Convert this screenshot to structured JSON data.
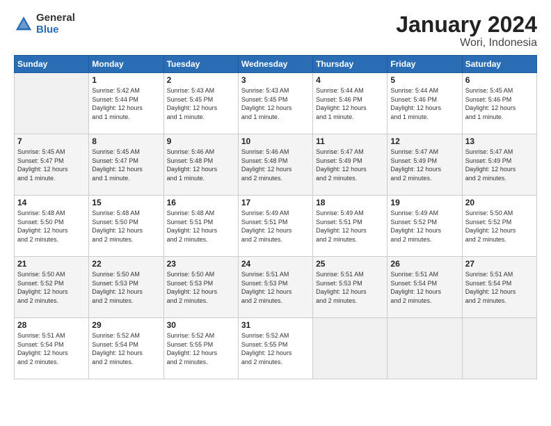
{
  "logo": {
    "general": "General",
    "blue": "Blue"
  },
  "title": "January 2024",
  "subtitle": "Wori, Indonesia",
  "headers": [
    "Sunday",
    "Monday",
    "Tuesday",
    "Wednesday",
    "Thursday",
    "Friday",
    "Saturday"
  ],
  "weeks": [
    [
      {
        "day": "",
        "info": ""
      },
      {
        "day": "1",
        "info": "Sunrise: 5:42 AM\nSunset: 5:44 PM\nDaylight: 12 hours\nand 1 minute."
      },
      {
        "day": "2",
        "info": "Sunrise: 5:43 AM\nSunset: 5:45 PM\nDaylight: 12 hours\nand 1 minute."
      },
      {
        "day": "3",
        "info": "Sunrise: 5:43 AM\nSunset: 5:45 PM\nDaylight: 12 hours\nand 1 minute."
      },
      {
        "day": "4",
        "info": "Sunrise: 5:44 AM\nSunset: 5:46 PM\nDaylight: 12 hours\nand 1 minute."
      },
      {
        "day": "5",
        "info": "Sunrise: 5:44 AM\nSunset: 5:46 PM\nDaylight: 12 hours\nand 1 minute."
      },
      {
        "day": "6",
        "info": "Sunrise: 5:45 AM\nSunset: 5:46 PM\nDaylight: 12 hours\nand 1 minute."
      }
    ],
    [
      {
        "day": "7",
        "info": "Sunrise: 5:45 AM\nSunset: 5:47 PM\nDaylight: 12 hours\nand 1 minute."
      },
      {
        "day": "8",
        "info": "Sunrise: 5:45 AM\nSunset: 5:47 PM\nDaylight: 12 hours\nand 1 minute."
      },
      {
        "day": "9",
        "info": "Sunrise: 5:46 AM\nSunset: 5:48 PM\nDaylight: 12 hours\nand 1 minute."
      },
      {
        "day": "10",
        "info": "Sunrise: 5:46 AM\nSunset: 5:48 PM\nDaylight: 12 hours\nand 2 minutes."
      },
      {
        "day": "11",
        "info": "Sunrise: 5:47 AM\nSunset: 5:49 PM\nDaylight: 12 hours\nand 2 minutes."
      },
      {
        "day": "12",
        "info": "Sunrise: 5:47 AM\nSunset: 5:49 PM\nDaylight: 12 hours\nand 2 minutes."
      },
      {
        "day": "13",
        "info": "Sunrise: 5:47 AM\nSunset: 5:49 PM\nDaylight: 12 hours\nand 2 minutes."
      }
    ],
    [
      {
        "day": "14",
        "info": "Sunrise: 5:48 AM\nSunset: 5:50 PM\nDaylight: 12 hours\nand 2 minutes."
      },
      {
        "day": "15",
        "info": "Sunrise: 5:48 AM\nSunset: 5:50 PM\nDaylight: 12 hours\nand 2 minutes."
      },
      {
        "day": "16",
        "info": "Sunrise: 5:48 AM\nSunset: 5:51 PM\nDaylight: 12 hours\nand 2 minutes."
      },
      {
        "day": "17",
        "info": "Sunrise: 5:49 AM\nSunset: 5:51 PM\nDaylight: 12 hours\nand 2 minutes."
      },
      {
        "day": "18",
        "info": "Sunrise: 5:49 AM\nSunset: 5:51 PM\nDaylight: 12 hours\nand 2 minutes."
      },
      {
        "day": "19",
        "info": "Sunrise: 5:49 AM\nSunset: 5:52 PM\nDaylight: 12 hours\nand 2 minutes."
      },
      {
        "day": "20",
        "info": "Sunrise: 5:50 AM\nSunset: 5:52 PM\nDaylight: 12 hours\nand 2 minutes."
      }
    ],
    [
      {
        "day": "21",
        "info": "Sunrise: 5:50 AM\nSunset: 5:52 PM\nDaylight: 12 hours\nand 2 minutes."
      },
      {
        "day": "22",
        "info": "Sunrise: 5:50 AM\nSunset: 5:53 PM\nDaylight: 12 hours\nand 2 minutes."
      },
      {
        "day": "23",
        "info": "Sunrise: 5:50 AM\nSunset: 5:53 PM\nDaylight: 12 hours\nand 2 minutes."
      },
      {
        "day": "24",
        "info": "Sunrise: 5:51 AM\nSunset: 5:53 PM\nDaylight: 12 hours\nand 2 minutes."
      },
      {
        "day": "25",
        "info": "Sunrise: 5:51 AM\nSunset: 5:53 PM\nDaylight: 12 hours\nand 2 minutes."
      },
      {
        "day": "26",
        "info": "Sunrise: 5:51 AM\nSunset: 5:54 PM\nDaylight: 12 hours\nand 2 minutes."
      },
      {
        "day": "27",
        "info": "Sunrise: 5:51 AM\nSunset: 5:54 PM\nDaylight: 12 hours\nand 2 minutes."
      }
    ],
    [
      {
        "day": "28",
        "info": "Sunrise: 5:51 AM\nSunset: 5:54 PM\nDaylight: 12 hours\nand 2 minutes."
      },
      {
        "day": "29",
        "info": "Sunrise: 5:52 AM\nSunset: 5:54 PM\nDaylight: 12 hours\nand 2 minutes."
      },
      {
        "day": "30",
        "info": "Sunrise: 5:52 AM\nSunset: 5:55 PM\nDaylight: 12 hours\nand 2 minutes."
      },
      {
        "day": "31",
        "info": "Sunrise: 5:52 AM\nSunset: 5:55 PM\nDaylight: 12 hours\nand 2 minutes."
      },
      {
        "day": "",
        "info": ""
      },
      {
        "day": "",
        "info": ""
      },
      {
        "day": "",
        "info": ""
      }
    ]
  ]
}
